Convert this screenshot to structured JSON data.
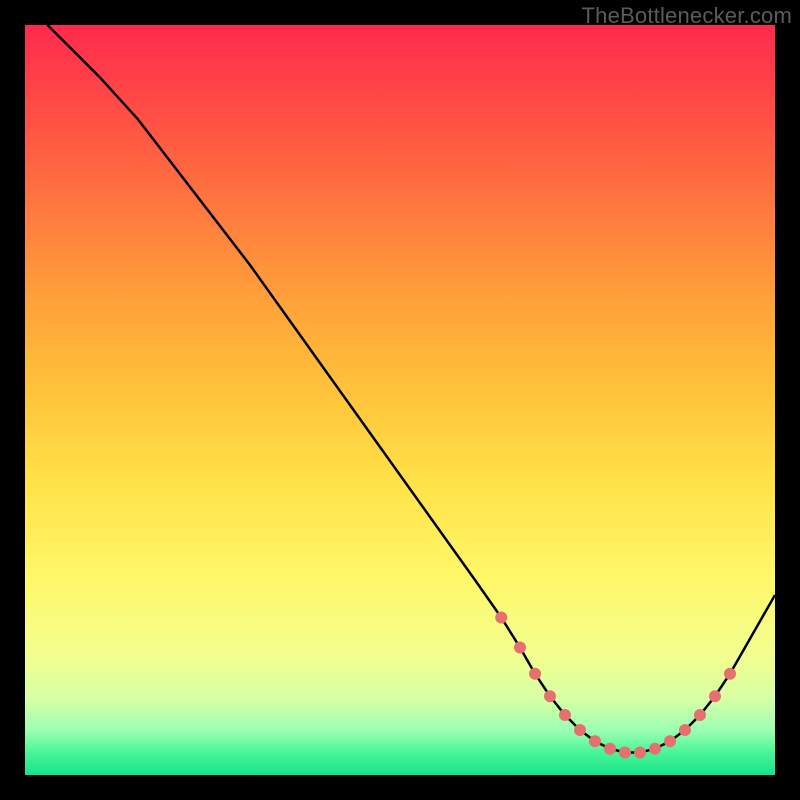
{
  "watermark": "TheBottlenecker.com",
  "colors": {
    "background": "#000000",
    "curve_stroke": "#000000",
    "dot_fill": "#e6706e",
    "gradient_top": "#ff2a4d",
    "gradient_bottom": "#17e38a"
  },
  "chart_data": {
    "type": "line",
    "title": "",
    "xlabel": "",
    "ylabel": "",
    "xlim": [
      0,
      100
    ],
    "ylim": [
      0,
      100
    ],
    "legend": null,
    "grid": false,
    "series": [
      {
        "name": "curve",
        "x": [
          3,
          6,
          10,
          15,
          20,
          25,
          30,
          35,
          40,
          45,
          50,
          55,
          60,
          63.5,
          66,
          68,
          70,
          72,
          74,
          76,
          78,
          80,
          82,
          84,
          86,
          88,
          90,
          92,
          94,
          96,
          98,
          100
        ],
        "y": [
          100,
          97,
          93,
          87.5,
          81,
          74.5,
          68,
          61,
          54,
          47,
          40,
          33,
          26,
          21,
          17,
          13.5,
          10.5,
          8,
          6,
          4.5,
          3.5,
          3,
          3,
          3.5,
          4.5,
          6,
          8,
          10.5,
          13.5,
          17,
          20.5,
          24
        ]
      }
    ],
    "points": [
      {
        "x": 63.5,
        "y": 21
      },
      {
        "x": 66,
        "y": 17
      },
      {
        "x": 68,
        "y": 13.5
      },
      {
        "x": 70,
        "y": 10.5
      },
      {
        "x": 72,
        "y": 8
      },
      {
        "x": 74,
        "y": 6
      },
      {
        "x": 76,
        "y": 4.5
      },
      {
        "x": 78,
        "y": 3.5
      },
      {
        "x": 80,
        "y": 3
      },
      {
        "x": 82,
        "y": 3
      },
      {
        "x": 84,
        "y": 3.5
      },
      {
        "x": 86,
        "y": 4.5
      },
      {
        "x": 88,
        "y": 6
      },
      {
        "x": 90,
        "y": 8
      },
      {
        "x": 92,
        "y": 10.5
      },
      {
        "x": 94,
        "y": 13.5
      }
    ]
  }
}
